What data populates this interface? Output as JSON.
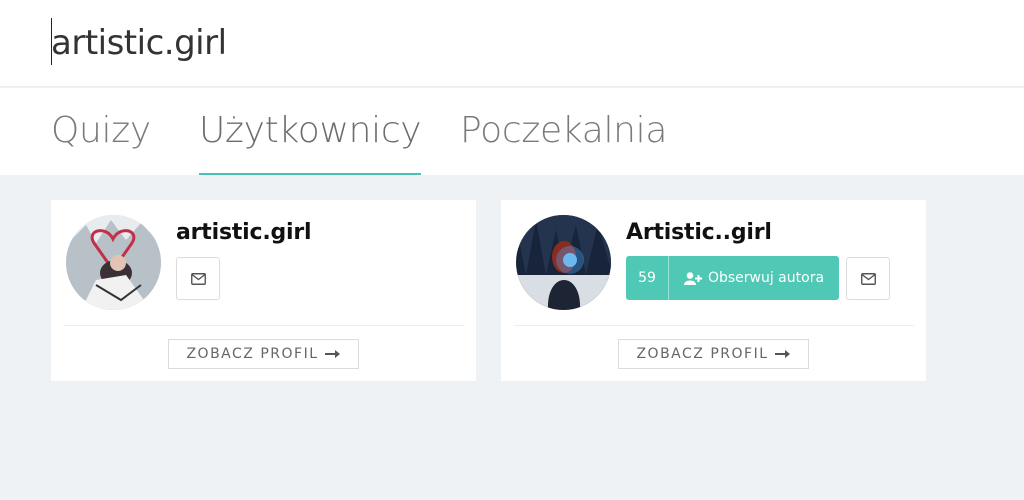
{
  "search": {
    "value": "artistic.girl"
  },
  "tabs": [
    {
      "label": "Quizy",
      "active": false
    },
    {
      "label": "Użytkownicy",
      "active": true
    },
    {
      "label": "Poczekalnia",
      "active": false
    }
  ],
  "results": [
    {
      "username": "artistic.girl",
      "message_icon": "envelope-icon",
      "profile_label": "ZOBACZ PROFIL",
      "profile_icon": "arrow-right-icon"
    },
    {
      "username": "Artistic..girl",
      "followers": "59",
      "follow_label": "Obserwuj autora",
      "follow_icon": "user-plus-icon",
      "message_icon": "envelope-icon",
      "profile_label": "ZOBACZ PROFIL",
      "profile_icon": "arrow-right-icon"
    }
  ],
  "colors": {
    "accent": "#4fc9b5",
    "tab_underline": "#48c3b2",
    "background": "#eff2f5"
  }
}
